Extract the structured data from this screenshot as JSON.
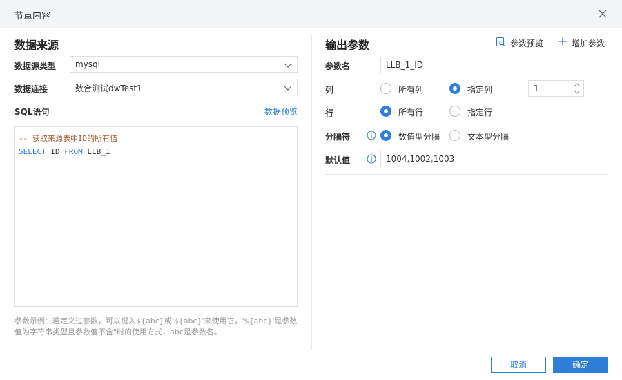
{
  "dialog": {
    "title": "节点内容"
  },
  "left": {
    "section_title": "数据来源",
    "datasource_type_label": "数据源类型",
    "datasource_type_value": "mysql",
    "connection_label": "数据连接",
    "connection_value": "数合测试dwTest1",
    "sql_label": "SQL语句",
    "preview_link": "数据预览",
    "sql_comment": "-- 获取来源表中ID的所有值",
    "sql_code": {
      "kw1": "SELECT",
      "col": " ID ",
      "kw2": "FROM",
      "table": " LLB_1"
    },
    "hint": "参数示例：若定义过参数，可以键入${abc}或'${abc}'来使用它，'${abc}'是参数值为字符串类型且参数值不含\"时的使用方式，abc是参数名。"
  },
  "right": {
    "section_title": "输出参数",
    "param_preview_label": "参数预览",
    "add_param_label": "增加参数",
    "param_name_label": "参数名",
    "param_name_value": "LLB_1_ID",
    "column_label": "列",
    "column_options": [
      "所有列",
      "指定列"
    ],
    "column_selected": "指定列",
    "column_number": "1",
    "row_label": "行",
    "row_options": [
      "所有行",
      "指定行"
    ],
    "row_selected": "所有行",
    "separator_label": "分隔符",
    "separator_options": [
      "数值型分隔",
      "文本型分隔"
    ],
    "separator_selected": "数值型分隔",
    "default_label": "默认值",
    "default_value": "1004,1002,1003"
  },
  "footer": {
    "cancel_label": "取消",
    "ok_label": "确定"
  },
  "colors": {
    "accent": "#2f7fd9",
    "comment": "#a0582c",
    "header_bg": "#f3f4f6"
  }
}
